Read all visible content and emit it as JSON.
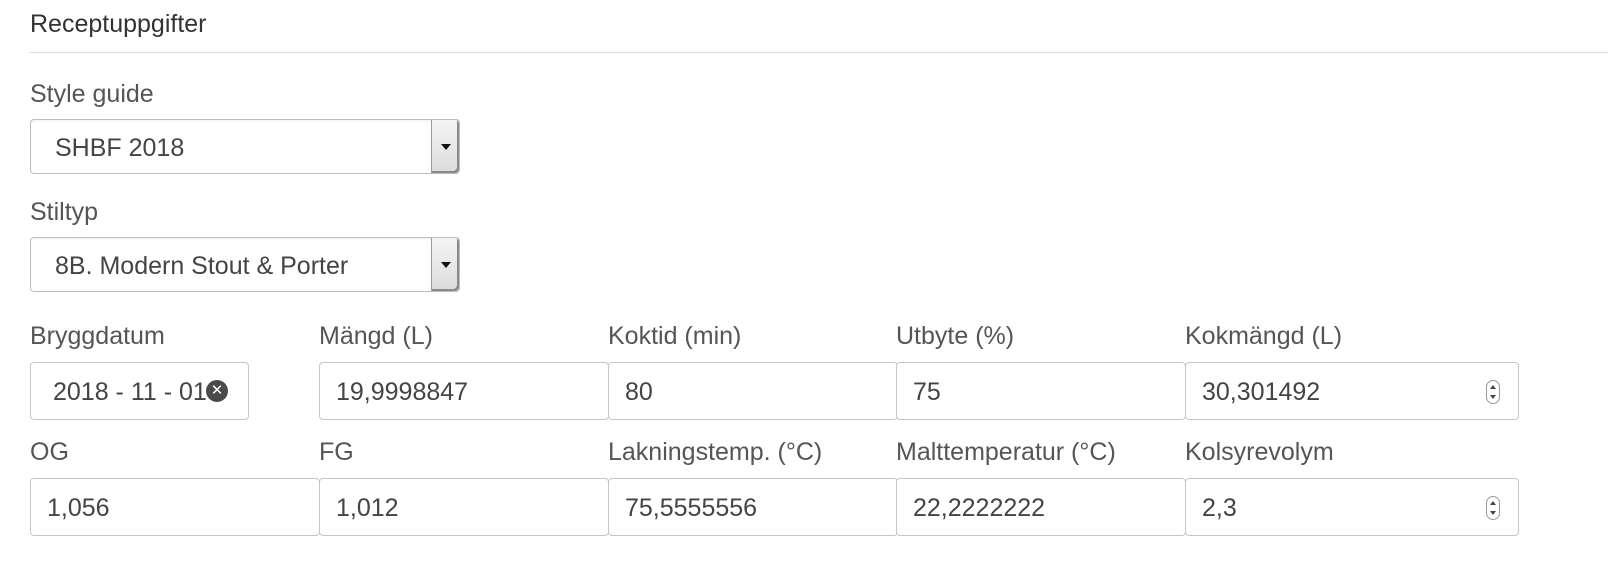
{
  "section": {
    "title": "Receptuppgifter"
  },
  "style_guide": {
    "label": "Style guide",
    "value": "SHBF 2018"
  },
  "style_type": {
    "label": "Stiltyp",
    "value": "8B. Modern Stout & Porter"
  },
  "row1": [
    {
      "key": "brew_date",
      "label": "Bryggdatum",
      "value": "2018 - 11 - 01"
    },
    {
      "key": "volume",
      "label": "Mängd (L)",
      "value": "19,9998847"
    },
    {
      "key": "boil_time",
      "label": "Koktid (min)",
      "value": "80"
    },
    {
      "key": "efficiency",
      "label": "Utbyte (%)",
      "value": "75"
    },
    {
      "key": "boil_volume",
      "label": "Kokmängd (L)",
      "value": "30,301492"
    }
  ],
  "row2": [
    {
      "key": "og",
      "label": "OG",
      "value": "1,056"
    },
    {
      "key": "fg",
      "label": "FG",
      "value": "1,012"
    },
    {
      "key": "sparge_temp",
      "label": "Lakningstemp. (°C)",
      "value": "75,5555556"
    },
    {
      "key": "malt_temp",
      "label": "Malttemperatur (°C)",
      "value": "22,2222222"
    },
    {
      "key": "co2_volume",
      "label": "Kolsyrevolym",
      "value": "2,3"
    }
  ],
  "icons": {
    "date_clear": "clear-circle-icon",
    "select_arrow": "dropdown-arrow-icon",
    "spinner": "number-spinner-icon"
  }
}
